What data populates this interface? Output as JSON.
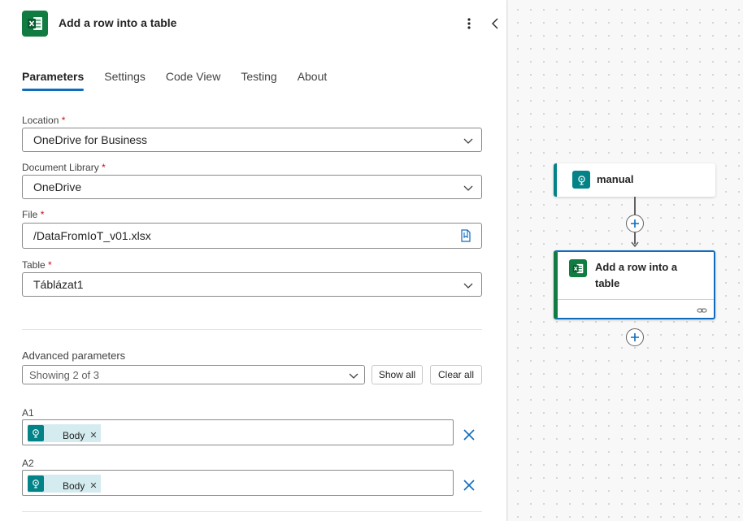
{
  "header": {
    "title": "Add a row into a table",
    "app_icon": "excel-icon",
    "accent": "#107c41"
  },
  "tabs": [
    {
      "label": "Parameters",
      "active": true
    },
    {
      "label": "Settings",
      "active": false
    },
    {
      "label": "Code View",
      "active": false
    },
    {
      "label": "Testing",
      "active": false
    },
    {
      "label": "About",
      "active": false
    }
  ],
  "fields": {
    "location": {
      "label": "Location",
      "required_mark": "*",
      "value": "OneDrive for Business"
    },
    "document_library": {
      "label": "Document Library",
      "required_mark": "*",
      "value": "OneDrive"
    },
    "file": {
      "label": "File",
      "required_mark": "*",
      "value": "/DataFromIoT_v01.xlsx"
    },
    "table": {
      "label": "Table",
      "required_mark": "*",
      "value": "Táblázat1"
    }
  },
  "advanced": {
    "label": "Advanced parameters",
    "select_value": "Showing 2 of 3",
    "show_all_label": "Show all",
    "clear_all_label": "Clear all"
  },
  "dynamic_fields": [
    {
      "label": "A1",
      "token": "Body"
    },
    {
      "label": "A2",
      "token": "Body"
    }
  ],
  "canvas": {
    "nodes": [
      {
        "title": "manual",
        "icon": "trigger-icon",
        "color": "#038387"
      },
      {
        "title_line1": "Add a row into a",
        "title_line2": "table",
        "icon": "excel-icon",
        "color": "#107c41",
        "selected_border": "#0f6cbd"
      }
    ]
  }
}
